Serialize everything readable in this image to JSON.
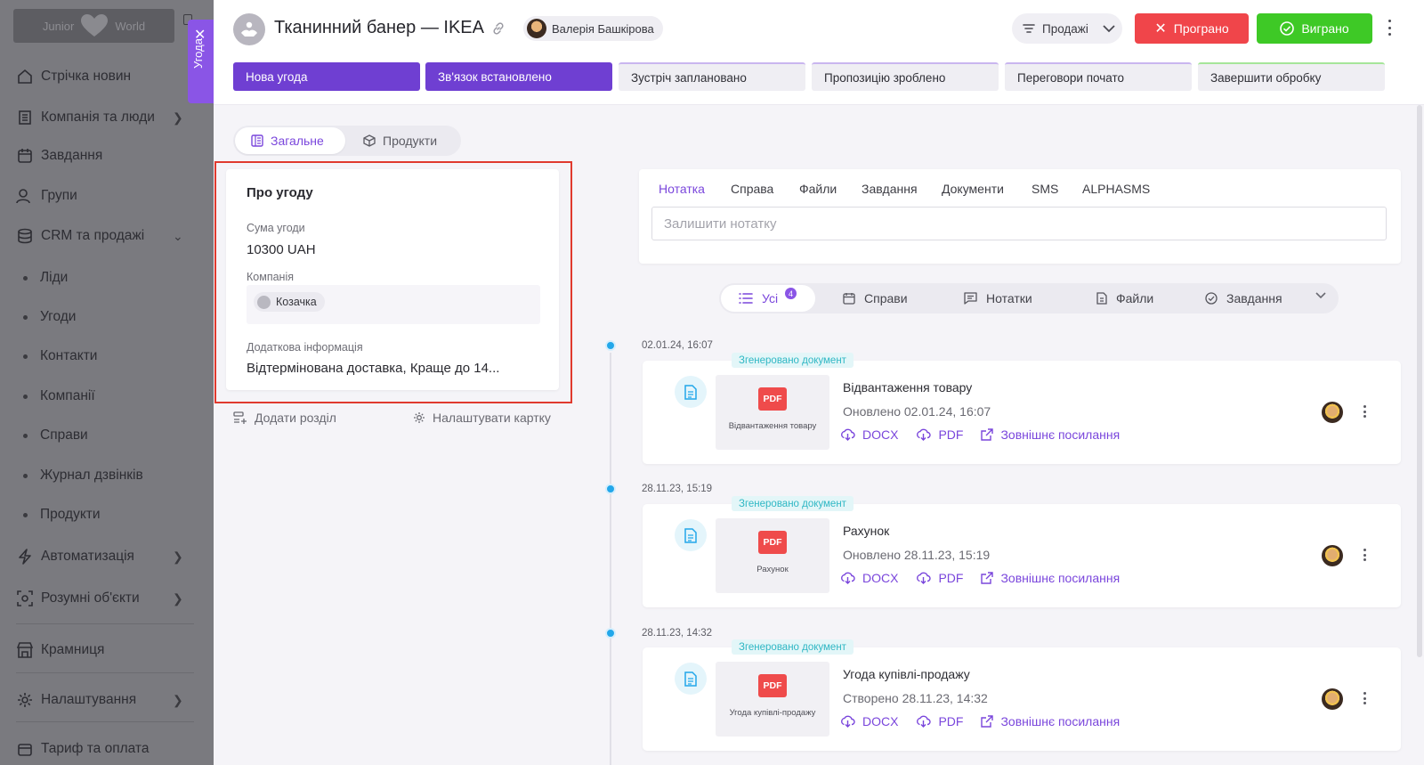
{
  "sidebar": {
    "logo_left": "Junior",
    "logo_right": "World",
    "items": [
      {
        "label": "Стрічка новин",
        "icon": "home-icon"
      },
      {
        "label": "Компанія та люди",
        "icon": "building-icon"
      },
      {
        "label": "Завдання",
        "icon": "calendar-icon"
      },
      {
        "label": "Групи",
        "icon": "users-icon"
      },
      {
        "label": "CRM та продажі",
        "icon": "database-icon"
      },
      {
        "label": "Автоматизація",
        "icon": "lightning-icon"
      },
      {
        "label": "Розумні об'єкти",
        "icon": "smart-object-icon"
      },
      {
        "label": "Крамниця",
        "icon": "store-icon"
      },
      {
        "label": "Налаштування",
        "icon": "gear-icon"
      },
      {
        "label": "Тариф та оплата",
        "icon": "billing-icon"
      }
    ],
    "subitems": [
      "Ліди",
      "Угоди",
      "Контакти",
      "Компанії",
      "Справи",
      "Журнал дзвінків",
      "Продукти"
    ]
  },
  "side_tab": {
    "label": "Угода"
  },
  "header": {
    "title": "Тканинний банер — IKEA",
    "owner": "Валерія Башкірова",
    "pipeline": "Продажі",
    "lost_label": "Програно",
    "won_label": "Виграно"
  },
  "stages": [
    "Нова угода",
    "Зв'язок встановлено",
    "Зустріч заплановано",
    "Пропозицію зроблено",
    "Переговори почато",
    "Завершити обробку"
  ],
  "segment": {
    "general": "Загальне",
    "products": "Продукти"
  },
  "info_card": {
    "title": "Про угоду",
    "amount_label": "Сума угоди",
    "amount_value": "10300 UAH",
    "company_label": "Компанія",
    "company_value": "Козачка",
    "extra_label": "Додаткова інформація",
    "extra_value": "Відтермінована доставка, Краще до 14..."
  },
  "left_actions": {
    "add_section": "Додати розділ",
    "configure_card": "Налаштувати картку"
  },
  "note": {
    "tabs": [
      "Нотатка",
      "Справа",
      "Файли",
      "Завдання",
      "Документи",
      "SMS",
      "ALPHASMS"
    ],
    "placeholder": "Залишити нотатку"
  },
  "filters": {
    "all": "Усі",
    "all_count": "4",
    "cases": "Справи",
    "notes": "Нотатки",
    "files": "Файли",
    "tasks": "Завдання"
  },
  "timeline": [
    {
      "date": "02.01.24, 16:07",
      "badge": "Згенеровано документ",
      "preview_tag": "PDF",
      "preview_caption": "Відвантаження товару",
      "name": "Відвантаження товару",
      "updated": "Оновлено 02.01.24, 16:07",
      "docx": "DOCX",
      "pdf": "PDF",
      "external": "Зовнішнє посилання"
    },
    {
      "date": "28.11.23, 15:19",
      "badge": "Згенеровано документ",
      "preview_tag": "PDF",
      "preview_caption": "Рахунок",
      "name": "Рахунок",
      "updated": "Оновлено 28.11.23, 15:19",
      "docx": "DOCX",
      "pdf": "PDF",
      "external": "Зовнішнє посилання"
    },
    {
      "date": "28.11.23, 14:32",
      "badge": "Згенеровано документ",
      "preview_tag": "PDF",
      "preview_caption": "Угода купівлі-продажу",
      "name": "Угода купівлі-продажу",
      "updated": "Створено 28.11.23, 14:32",
      "docx": "DOCX",
      "pdf": "PDF",
      "external": "Зовнішнє посилання"
    }
  ],
  "colors": {
    "accent": "#7a46dc",
    "stage_active": "#6f3fd2",
    "lost": "#f0454a",
    "won": "#3ec926",
    "timeline_dot": "#22a7ea",
    "highlight": "#e03a2e"
  }
}
